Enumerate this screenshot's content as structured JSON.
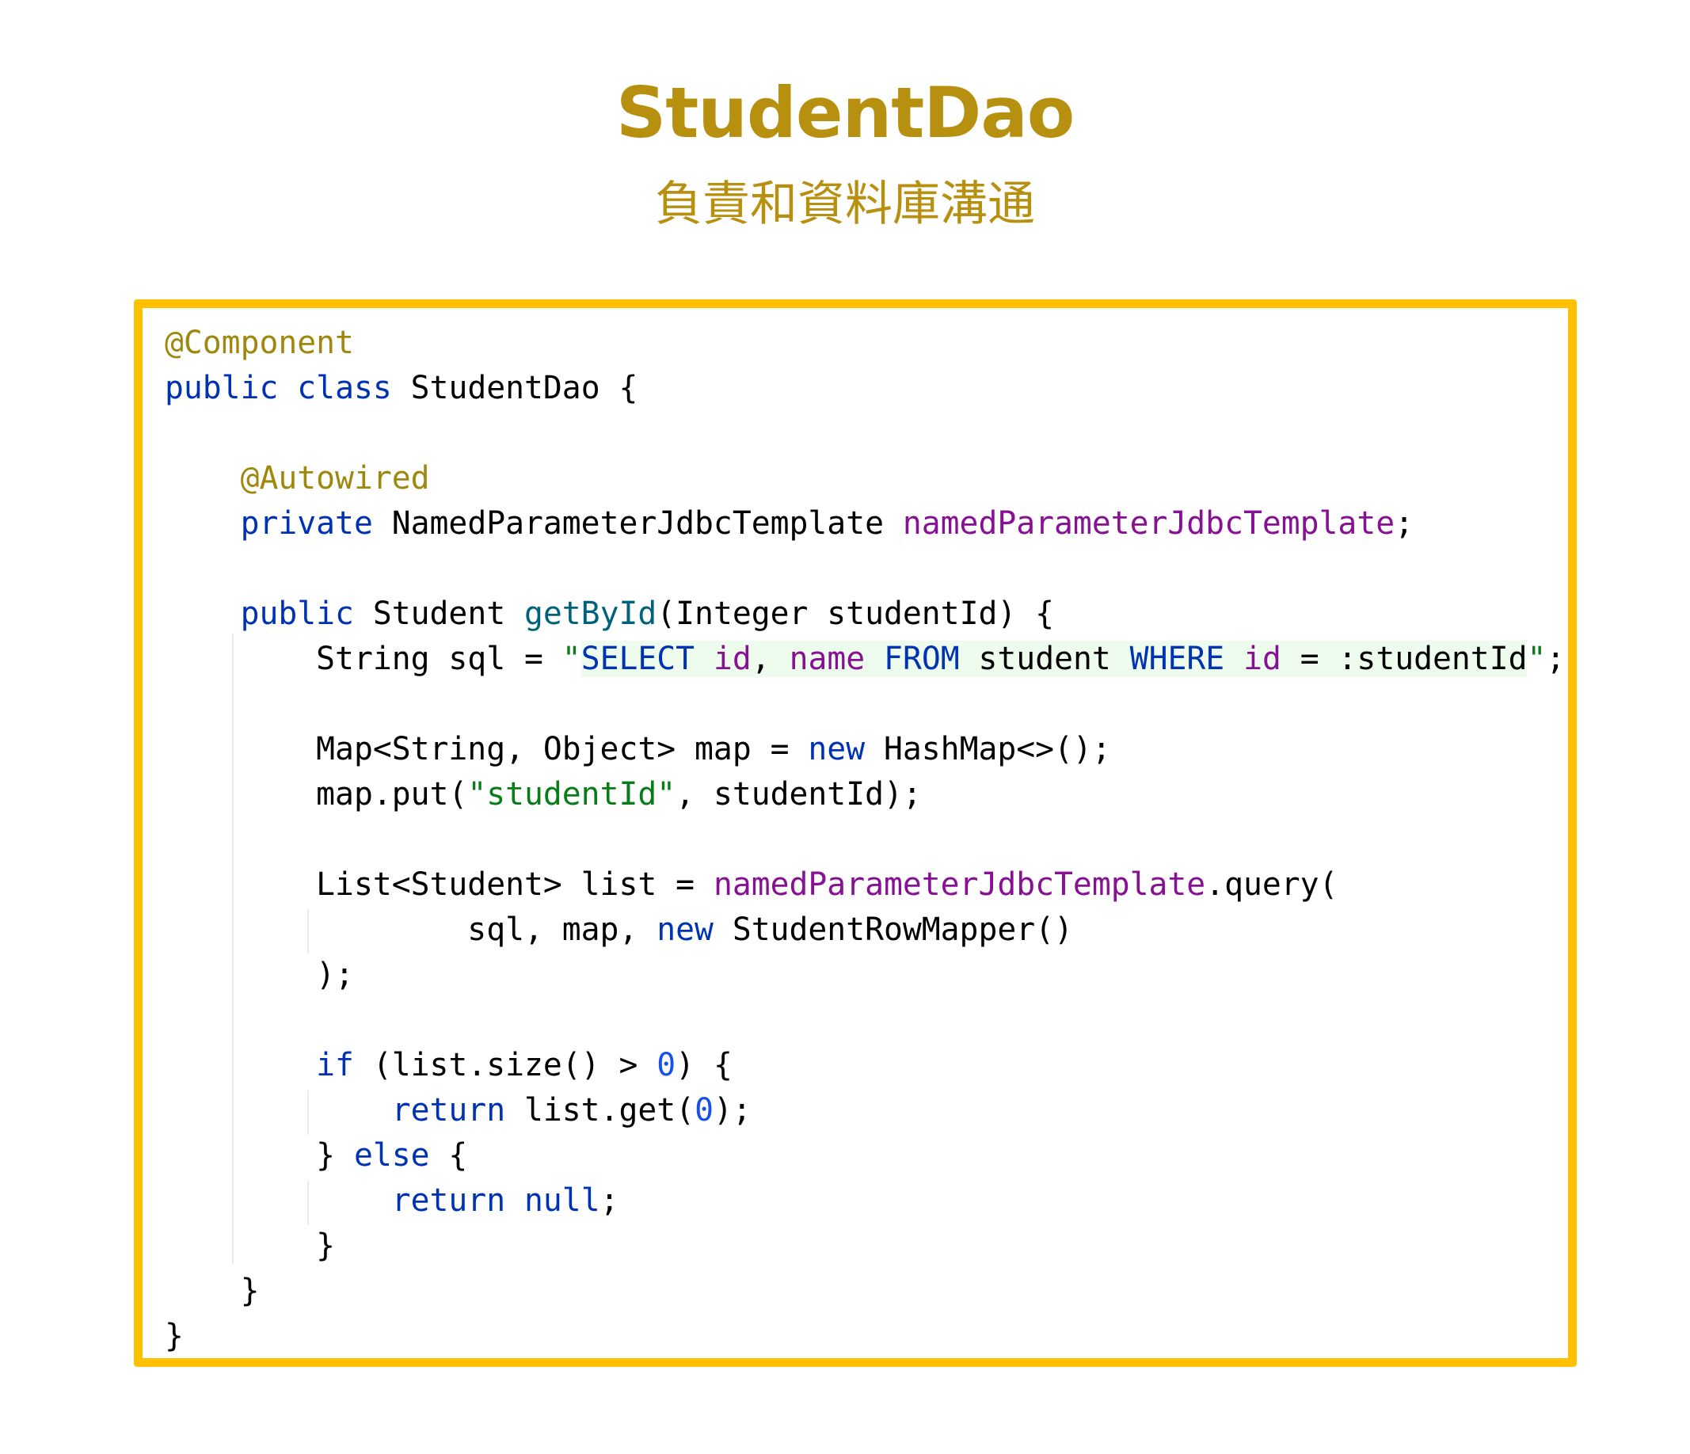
{
  "header": {
    "title": "StudentDao",
    "subtitle": "負責和資料庫溝通"
  },
  "colors": {
    "accent": "#b8900f",
    "box_border": "#ffc000",
    "keyword": "#0033b3",
    "annotation": "#9e880d",
    "field": "#871094",
    "method": "#00627a",
    "string": "#067d17",
    "number": "#1750eb",
    "plain": "#000000",
    "string_highlight": "#edfced"
  },
  "code": {
    "language": "java",
    "lines": [
      [
        {
          "t": "@Component",
          "k": "annotation"
        }
      ],
      [
        {
          "t": "public",
          "k": "keyword"
        },
        {
          "t": " "
        },
        {
          "t": "class",
          "k": "keyword"
        },
        {
          "t": " StudentDao {"
        }
      ],
      [],
      [
        {
          "t": "    "
        },
        {
          "t": "@Autowired",
          "k": "annotation"
        }
      ],
      [
        {
          "t": "    "
        },
        {
          "t": "private",
          "k": "keyword"
        },
        {
          "t": " NamedParameterJdbcTemplate "
        },
        {
          "t": "namedParameterJdbcTemplate",
          "k": "field"
        },
        {
          "t": ";"
        }
      ],
      [],
      [
        {
          "t": "    "
        },
        {
          "t": "public",
          "k": "keyword"
        },
        {
          "t": " Student "
        },
        {
          "t": "getById",
          "k": "method"
        },
        {
          "t": "(Integer studentId) {"
        }
      ],
      [
        {
          "t": "        String sql = "
        },
        {
          "t": "\"",
          "k": "string"
        },
        {
          "t": "SELECT",
          "k": "keyword",
          "hl": true
        },
        {
          "t": " ",
          "hl": true
        },
        {
          "t": "id",
          "k": "field",
          "hl": true
        },
        {
          "t": ", ",
          "hl": true
        },
        {
          "t": "name",
          "k": "field",
          "hl": true
        },
        {
          "t": " ",
          "hl": true
        },
        {
          "t": "FROM",
          "k": "keyword",
          "hl": true
        },
        {
          "t": " student ",
          "hl": true
        },
        {
          "t": "WHERE",
          "k": "keyword",
          "hl": true
        },
        {
          "t": " ",
          "hl": true
        },
        {
          "t": "id",
          "k": "field",
          "hl": true
        },
        {
          "t": " = :studentId",
          "hl": true
        },
        {
          "t": "\"",
          "k": "string"
        },
        {
          "t": ";"
        }
      ],
      [],
      [
        {
          "t": "        Map<String, Object> map = "
        },
        {
          "t": "new",
          "k": "keyword"
        },
        {
          "t": " HashMap<>();"
        }
      ],
      [
        {
          "t": "        map.put("
        },
        {
          "t": "\"studentId\"",
          "k": "string"
        },
        {
          "t": ", studentId);"
        }
      ],
      [],
      [
        {
          "t": "        List<Student> list = "
        },
        {
          "t": "namedParameterJdbcTemplate",
          "k": "field"
        },
        {
          "t": ".query("
        }
      ],
      [
        {
          "t": "                sql, map, "
        },
        {
          "t": "new",
          "k": "keyword"
        },
        {
          "t": " StudentRowMapper()"
        }
      ],
      [
        {
          "t": "        );"
        }
      ],
      [],
      [
        {
          "t": "        "
        },
        {
          "t": "if",
          "k": "keyword"
        },
        {
          "t": " (list.size() > "
        },
        {
          "t": "0",
          "k": "number"
        },
        {
          "t": ") {"
        }
      ],
      [
        {
          "t": "            "
        },
        {
          "t": "return",
          "k": "keyword"
        },
        {
          "t": " list.get("
        },
        {
          "t": "0",
          "k": "number"
        },
        {
          "t": ");"
        }
      ],
      [
        {
          "t": "        } "
        },
        {
          "t": "else",
          "k": "keyword"
        },
        {
          "t": " {"
        }
      ],
      [
        {
          "t": "            "
        },
        {
          "t": "return",
          "k": "keyword"
        },
        {
          "t": " "
        },
        {
          "t": "null",
          "k": "keyword"
        },
        {
          "t": ";"
        }
      ],
      [
        {
          "t": "        }"
        }
      ],
      [
        {
          "t": "    }"
        }
      ],
      [
        {
          "t": "}"
        }
      ]
    ]
  }
}
